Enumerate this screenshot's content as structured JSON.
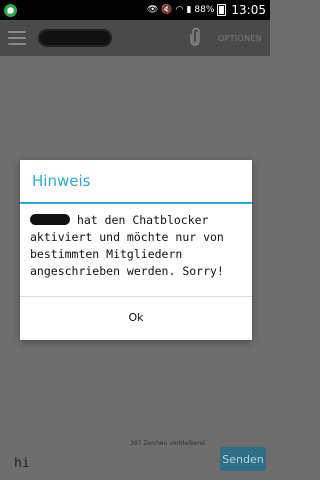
{
  "status_bar": {
    "app_icon": "whatsapp-icon",
    "battery": "88%",
    "time": "13:05"
  },
  "toolbar": {
    "menu_icon": "hamburger-menu-icon",
    "attach_icon": "paperclip-icon",
    "options_label": "OPTIONEN"
  },
  "dialog": {
    "title": "Hinweis",
    "message": "hat den Chatblocker aktiviert und möchte nur von bestimmten Mitgliedern angeschrieben werden. Sorry!",
    "ok_label": "Ok"
  },
  "composer": {
    "char_counter": "397 Zeichen verbleibend",
    "input_value": "hi",
    "send_label": "Senden"
  },
  "colors": {
    "accent": "#31a9d4",
    "overlay": "#6e6e6e",
    "send_button": "#2e6f86"
  }
}
